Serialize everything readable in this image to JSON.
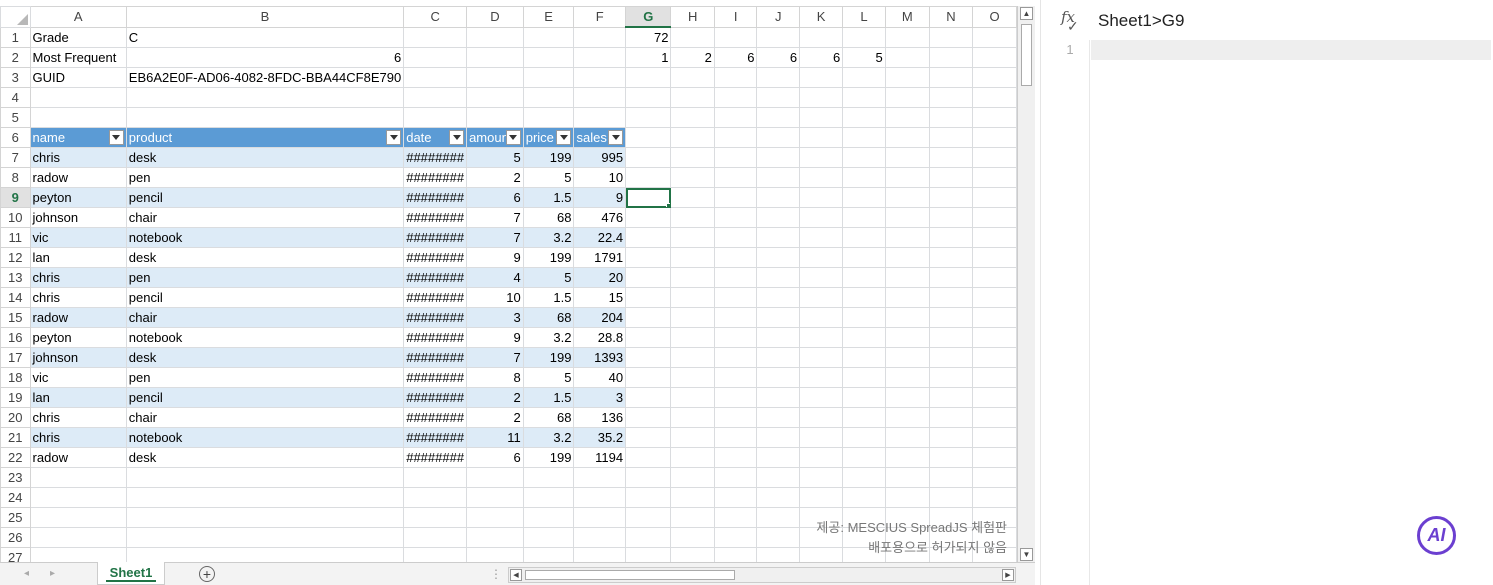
{
  "columns": [
    "A",
    "B",
    "C",
    "D",
    "E",
    "F",
    "G",
    "H",
    "I",
    "J",
    "K",
    "L",
    "M",
    "N",
    "O"
  ],
  "active_col": "G",
  "active_row": 9,
  "rows": [
    {
      "n": "1",
      "cells": {
        "A": "Grade",
        "B": "C",
        "G": "72"
      }
    },
    {
      "n": "2",
      "cells": {
        "A": "Most Frequent",
        "B": "6",
        "G": "1",
        "H": "2",
        "I": "6",
        "J": "6",
        "K": "6",
        "L": "5"
      }
    },
    {
      "n": "3",
      "cells": {
        "A": "GUID",
        "B": "EB6A2E0F-AD06-4082-8FDC-BBA44CF8E790"
      }
    },
    {
      "n": "4",
      "cells": {}
    },
    {
      "n": "5",
      "cells": {}
    }
  ],
  "table_header_row": "6",
  "table_headers": [
    "name",
    "product",
    "date",
    "amount",
    "price",
    "sales"
  ],
  "table_rows": [
    {
      "n": "7",
      "vals": [
        "chris",
        "desk",
        "########",
        "5",
        "199",
        "995"
      ]
    },
    {
      "n": "8",
      "vals": [
        "radow",
        "pen",
        "########",
        "2",
        "5",
        "10"
      ]
    },
    {
      "n": "9",
      "vals": [
        "peyton",
        "pencil",
        "########",
        "6",
        "1.5",
        "9"
      ]
    },
    {
      "n": "10",
      "vals": [
        "johnson",
        "chair",
        "########",
        "7",
        "68",
        "476"
      ]
    },
    {
      "n": "11",
      "vals": [
        "vic",
        "notebook",
        "########",
        "7",
        "3.2",
        "22.4"
      ]
    },
    {
      "n": "12",
      "vals": [
        "lan",
        "desk",
        "########",
        "9",
        "199",
        "1791"
      ]
    },
    {
      "n": "13",
      "vals": [
        "chris",
        "pen",
        "########",
        "4",
        "5",
        "20"
      ]
    },
    {
      "n": "14",
      "vals": [
        "chris",
        "pencil",
        "########",
        "10",
        "1.5",
        "15"
      ]
    },
    {
      "n": "15",
      "vals": [
        "radow",
        "chair",
        "########",
        "3",
        "68",
        "204"
      ]
    },
    {
      "n": "16",
      "vals": [
        "peyton",
        "notebook",
        "########",
        "9",
        "3.2",
        "28.8"
      ]
    },
    {
      "n": "17",
      "vals": [
        "johnson",
        "desk",
        "########",
        "7",
        "199",
        "1393"
      ]
    },
    {
      "n": "18",
      "vals": [
        "vic",
        "pen",
        "########",
        "8",
        "5",
        "40"
      ]
    },
    {
      "n": "19",
      "vals": [
        "lan",
        "pencil",
        "########",
        "2",
        "1.5",
        "3"
      ]
    },
    {
      "n": "20",
      "vals": [
        "chris",
        "chair",
        "########",
        "2",
        "68",
        "136"
      ]
    },
    {
      "n": "21",
      "vals": [
        "chris",
        "notebook",
        "########",
        "11",
        "3.2",
        "35.2"
      ]
    },
    {
      "n": "22",
      "vals": [
        "radow",
        "desk",
        "########",
        "6",
        "199",
        "1194"
      ]
    }
  ],
  "empty_rows": [
    "23",
    "24",
    "25",
    "26",
    "27"
  ],
  "watermark": {
    "line1": "제공: MESCIUS SpreadJS 체험판",
    "line2": "배포용으로 허가되지 않음"
  },
  "sheet_tab": "Sheet1",
  "formula_panel": {
    "cell_ref": "Sheet1>G9",
    "line_number": "1"
  },
  "ai_button": "AI",
  "icons": {
    "fx": "fx-check-icon",
    "add": "add-sheet-icon",
    "ai": "ai-assistant-icon"
  },
  "colors": {
    "accent": "#217346",
    "table_header": "#5b9bd5",
    "table_band": "#ddebf7",
    "ai": "#6b3fd0"
  }
}
